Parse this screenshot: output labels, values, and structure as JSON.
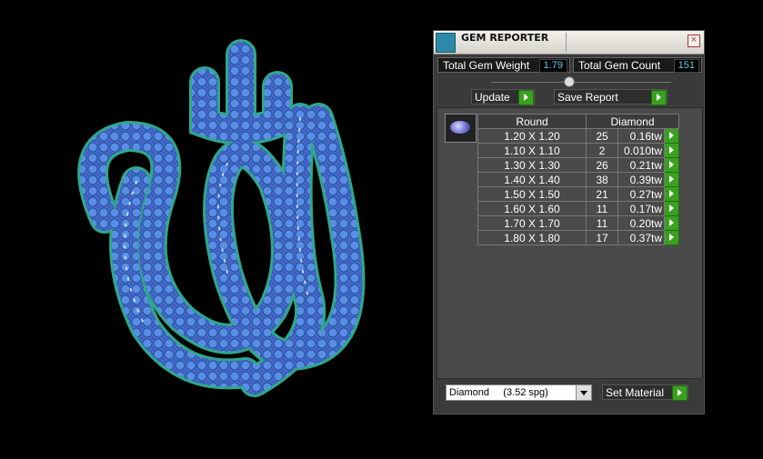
{
  "panel": {
    "title": "GEM REPORTER",
    "close_symbol": "×",
    "icon": "gem-reporter-icon",
    "total_weight_label": "Total Gem Weight",
    "total_weight_value": "1.79",
    "total_count_label": "Total Gem Count",
    "total_count_value": "151",
    "update_label": "Update",
    "save_report_label": "Save Report",
    "table": {
      "col1": "Round",
      "col2": "Diamond",
      "rows": [
        {
          "size": "1.20 X 1.20",
          "count": "25",
          "weight": "0.16tw"
        },
        {
          "size": "1.10 X 1.10",
          "count": "2",
          "weight": "0.010tw"
        },
        {
          "size": "1.30 X 1.30",
          "count": "26",
          "weight": "0.21tw"
        },
        {
          "size": "1.40 X 1.40",
          "count": "38",
          "weight": "0.39tw"
        },
        {
          "size": "1.50 X 1.50",
          "count": "21",
          "weight": "0.27tw"
        },
        {
          "size": "1.60 X 1.60",
          "count": "11",
          "weight": "0.17tw"
        },
        {
          "size": "1.70 X 1.70",
          "count": "11",
          "weight": "0.20tw"
        },
        {
          "size": "1.80 X 1.80",
          "count": "17",
          "weight": "0.37tw"
        }
      ]
    },
    "material_select": "Diamond     (3.52 spg)",
    "set_material_label": "Set Material"
  },
  "colors": {
    "accent_green": "#3aa020",
    "value_cyan": "#5ccfe6",
    "gem_blue": "#4a7fd8"
  }
}
